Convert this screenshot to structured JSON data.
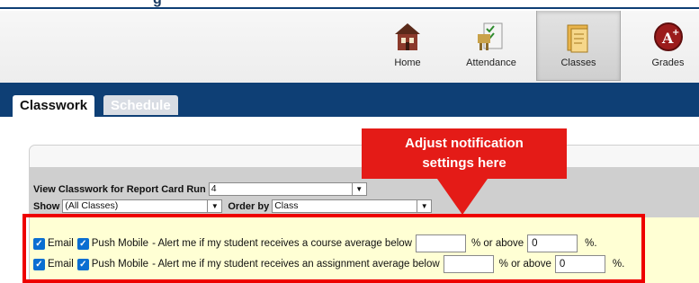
{
  "top": {
    "title_fragment": "g"
  },
  "nav": {
    "items": [
      {
        "label": "Home",
        "icon": "home-icon"
      },
      {
        "label": "Attendance",
        "icon": "attendance-icon"
      },
      {
        "label": "Classes",
        "icon": "classes-icon"
      },
      {
        "label": "Grades",
        "icon": "grades-icon"
      }
    ],
    "active": "Classes"
  },
  "tabs": {
    "items": [
      {
        "label": "Classwork"
      },
      {
        "label": "Schedule"
      }
    ],
    "active": "Classwork"
  },
  "filters": {
    "report_card_run_label": "View Classwork for Report Card Run",
    "report_card_run_value": "4",
    "show_label": "Show",
    "show_value": "(All Classes)",
    "order_label": "Order by",
    "order_value": "Class"
  },
  "alerts": {
    "rows": [
      {
        "email_label": "Email",
        "push_label": "Push Mobile",
        "text": "- Alert me if my student receives a course average below",
        "below_value": "",
        "or_above_label": "% or above",
        "above_value": "0",
        "percent": "%."
      },
      {
        "email_label": "Email",
        "push_label": "Push Mobile",
        "text": "- Alert me if my student receives an assignment average below",
        "below_value": "",
        "or_above_label": "% or above",
        "above_value": "0",
        "percent": "%."
      }
    ]
  },
  "callout": {
    "line1": "Adjust notification",
    "line2": "settings here"
  },
  "colors": {
    "brand_navy": "#0e3f75",
    "callout_red": "#e41b17",
    "alert_bg": "#ffffd4"
  }
}
